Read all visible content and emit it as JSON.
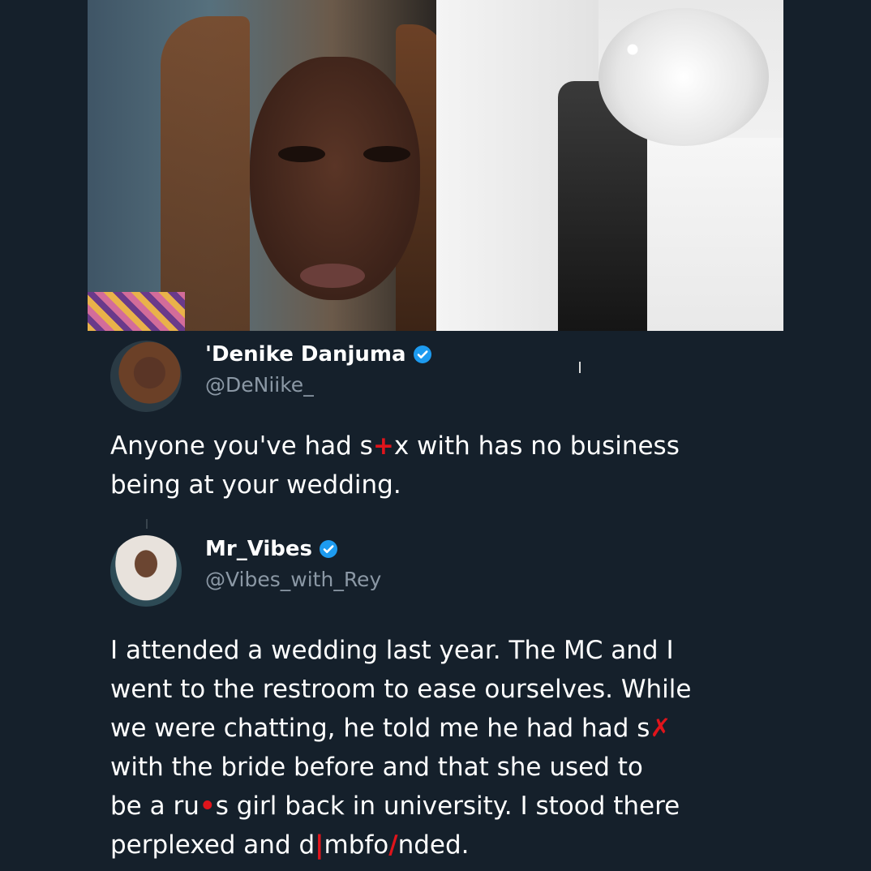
{
  "tweet1": {
    "display_name": "'Denike Danjuma",
    "handle": "@DeNiike_",
    "verified": true,
    "text_line1_a": "Anyone you've had s",
    "text_line1_b": "x with has no business",
    "text_line2": "being at your wedding."
  },
  "tweet2": {
    "display_name": "Mr_Vibes",
    "handle": "@Vibes_with_Rey",
    "verified": true,
    "lines": [
      "I attended a wedding last year. The MC and I",
      "went to the restroom to ease ourselves. While",
      "we were chatting, he told me he had had s",
      "with the bride before and that she used to",
      "be a ru",
      "s girl back in university. I stood there",
      "perplexed and d",
      "mbfo",
      "nded."
    ]
  },
  "colors": {
    "background": "#15202b",
    "secondary_text": "#8b98a5",
    "verified_badge": "#1d9bf0",
    "censor_marks": "#e0141b"
  }
}
